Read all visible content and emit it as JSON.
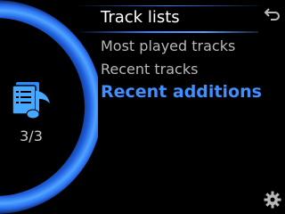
{
  "dial": {
    "icon": "music-document-icon",
    "counter": "3/3",
    "accent_color": "#2f7dff"
  },
  "menu": {
    "title": "Track lists",
    "items": [
      {
        "label": "Most played tracks",
        "selected": false
      },
      {
        "label": "Recent tracks",
        "selected": false
      },
      {
        "label": "Recent additions",
        "selected": true
      }
    ]
  },
  "controls": {
    "back_icon": "back-arrow-icon",
    "settings_icon": "gear-icon"
  },
  "colors": {
    "background": "#000000",
    "text": "#b8b8b8",
    "title": "#ffffff",
    "selected": "#3f8fff"
  }
}
